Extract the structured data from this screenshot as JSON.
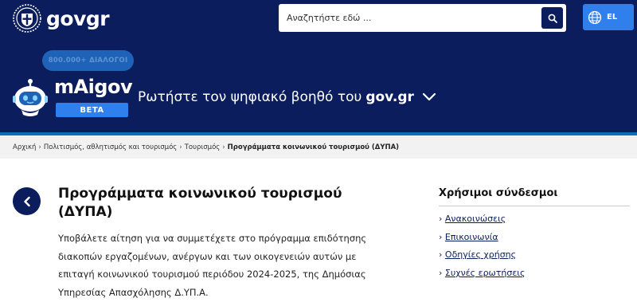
{
  "header": {
    "logo_text": "govgr",
    "search_placeholder": "Αναζητήστε εδώ ...",
    "language": "EL"
  },
  "assistant": {
    "bubble": "800.000+ ΔΙΑΛΟΓΟΙ",
    "name": "mAigov",
    "badge": "BETA",
    "prompt": "Ρωτήστε τον ψηφιακό βοηθό του",
    "prompt_bold": "gov.gr"
  },
  "breadcrumb": [
    "Αρχική",
    "Πολιτισμός, αθλητισμός και τουρισμός",
    "Τουρισμός",
    "Προγράμματα κοινωνικού τουρισμού (ΔΥΠΑ)"
  ],
  "main": {
    "title": "Προγράμματα κοινωνικού τουρισμού (ΔΥΠΑ)",
    "description": "Υποβάλετε αίτηση για να συμμετέχετε στο πρόγραμμα επιδότησης διακοπών εργαζομένων, ανέργων και των οικογενειών αυτών  με επιταγή κοινωνικού τουρισμού περιόδου 2024-2025, της Δημόσιας Υπηρεσίας Απασχόλησης Δ.ΥΠ.Α."
  },
  "sidebar": {
    "title": "Χρήσιμοι σύνδεσμοι",
    "links": [
      "Ανακοινώσεις",
      "Επικοινωνία",
      "Οδηγίες χρήσης",
      "Συχνές ερωτήσεις"
    ]
  },
  "colors": {
    "header_bg": "#0b1d5c",
    "accent_blue": "#2f80ed",
    "breadcrumb_rule": "#0b6fb8"
  }
}
